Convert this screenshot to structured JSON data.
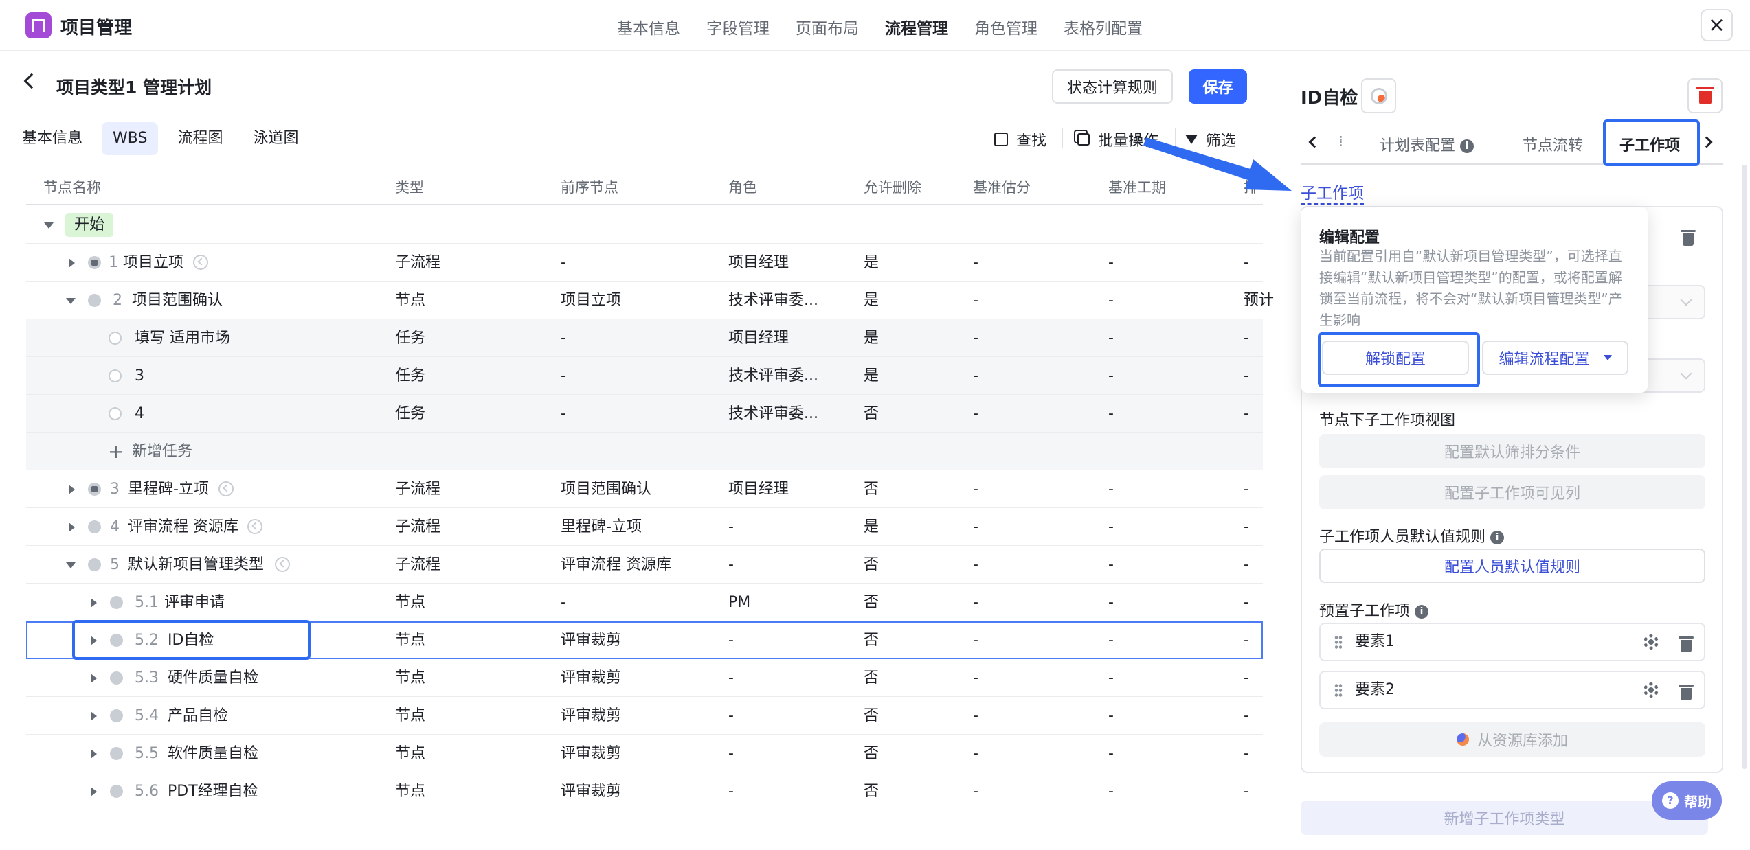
{
  "app": {
    "title": "项目管理"
  },
  "topnav": [
    "基本信息",
    "字段管理",
    "页面布局",
    "流程管理",
    "角色管理",
    "表格列配置"
  ],
  "header": {
    "title": "项目类型1 管理计划",
    "rule_button": "状态计算规则",
    "save_button": "保存"
  },
  "view_tabs": [
    "基本信息",
    "WBS",
    "流程图",
    "泳道图"
  ],
  "toolbar": {
    "find": "查找",
    "batch": "批量操作",
    "filter": "筛选"
  },
  "table": {
    "columns": [
      "节点名称",
      "类型",
      "前序节点",
      "角色",
      "允许删除",
      "基准估分",
      "基准工期",
      "排"
    ],
    "start_label": "开始",
    "add_task": "新增任务",
    "rows": [
      {
        "num": "1",
        "name": "项目立项",
        "type": "子流程",
        "prev": "-",
        "role": "项目经理",
        "del": "是",
        "est": "-",
        "dur": "-",
        "extra": "-"
      },
      {
        "num": "2",
        "name": "项目范围确认",
        "type": "节点",
        "prev": "项目立项",
        "role": "技术评审委...",
        "del": "是",
        "est": "-",
        "dur": "-",
        "extra": "预计"
      },
      {
        "num": "",
        "name": "填写 适用市场",
        "type": "任务",
        "prev": "-",
        "role": "项目经理",
        "del": "是",
        "est": "-",
        "dur": "-",
        "extra": "-"
      },
      {
        "num": "",
        "name": "3",
        "type": "任务",
        "prev": "-",
        "role": "技术评审委...",
        "del": "是",
        "est": "-",
        "dur": "-",
        "extra": "-"
      },
      {
        "num": "",
        "name": "4",
        "type": "任务",
        "prev": "-",
        "role": "技术评审委...",
        "del": "否",
        "est": "-",
        "dur": "-",
        "extra": "-"
      },
      {
        "num": "3",
        "name": "里程碑-立项",
        "type": "子流程",
        "prev": "项目范围确认",
        "role": "项目经理",
        "del": "否",
        "est": "-",
        "dur": "-",
        "extra": "-"
      },
      {
        "num": "4",
        "name": "评审流程 资源库",
        "type": "子流程",
        "prev": "里程碑-立项",
        "role": "-",
        "del": "是",
        "est": "-",
        "dur": "-",
        "extra": "-"
      },
      {
        "num": "5",
        "name": "默认新项目管理类型",
        "type": "子流程",
        "prev": "评审流程 资源库",
        "role": "-",
        "del": "否",
        "est": "-",
        "dur": "-",
        "extra": "-"
      },
      {
        "num": "5.1",
        "name": "评审申请",
        "type": "节点",
        "prev": "-",
        "role": "PM",
        "del": "否",
        "est": "-",
        "dur": "-",
        "extra": "-"
      },
      {
        "num": "5.2",
        "name": "ID自检",
        "type": "节点",
        "prev": "评审裁剪",
        "role": "-",
        "del": "否",
        "est": "-",
        "dur": "-",
        "extra": "-"
      },
      {
        "num": "5.3",
        "name": "硬件质量自检",
        "type": "节点",
        "prev": "评审裁剪",
        "role": "-",
        "del": "否",
        "est": "-",
        "dur": "-",
        "extra": "-"
      },
      {
        "num": "5.4",
        "name": "产品自检",
        "type": "节点",
        "prev": "评审裁剪",
        "role": "-",
        "del": "否",
        "est": "-",
        "dur": "-",
        "extra": "-"
      },
      {
        "num": "5.5",
        "name": "软件质量自检",
        "type": "节点",
        "prev": "评审裁剪",
        "role": "-",
        "del": "否",
        "est": "-",
        "dur": "-",
        "extra": "-"
      },
      {
        "num": "5.6",
        "name": "PDT经理自检",
        "type": "节点",
        "prev": "评审裁剪",
        "role": "-",
        "del": "否",
        "est": "-",
        "dur": "-",
        "extra": "-"
      }
    ]
  },
  "panel": {
    "title": "ID自检",
    "tabs": [
      "计划表配置",
      "节点流转",
      "子工作项"
    ],
    "section_link": "子工作项",
    "popover": {
      "title": "编辑配置",
      "desc": "当前配置引用自“默认新项目管理类型”，可选择直接编辑“默认新项目管理类型”的配置，或将配置解锁至当前流程，将不会对“默认新项目管理类型”产生影响",
      "unlock": "解锁配置",
      "edit": "编辑流程配置"
    },
    "view_label": "节点下子工作项视图",
    "btn_sort": "配置默认筛排分条件",
    "btn_cols": "配置子工作项可见列",
    "default_rule_label": "子工作项人员默认值规则",
    "btn_default_rule": "配置人员默认值规则",
    "preset_label": "预置子工作项",
    "items": [
      "要素1",
      "要素2"
    ],
    "add_from_lib": "从资源库添加",
    "new_type": "新增子工作项类型",
    "help": "帮助"
  },
  "colors": {
    "accent": "#3366ff",
    "highlight": "#2f6bf0",
    "danger": "#e22e28"
  }
}
